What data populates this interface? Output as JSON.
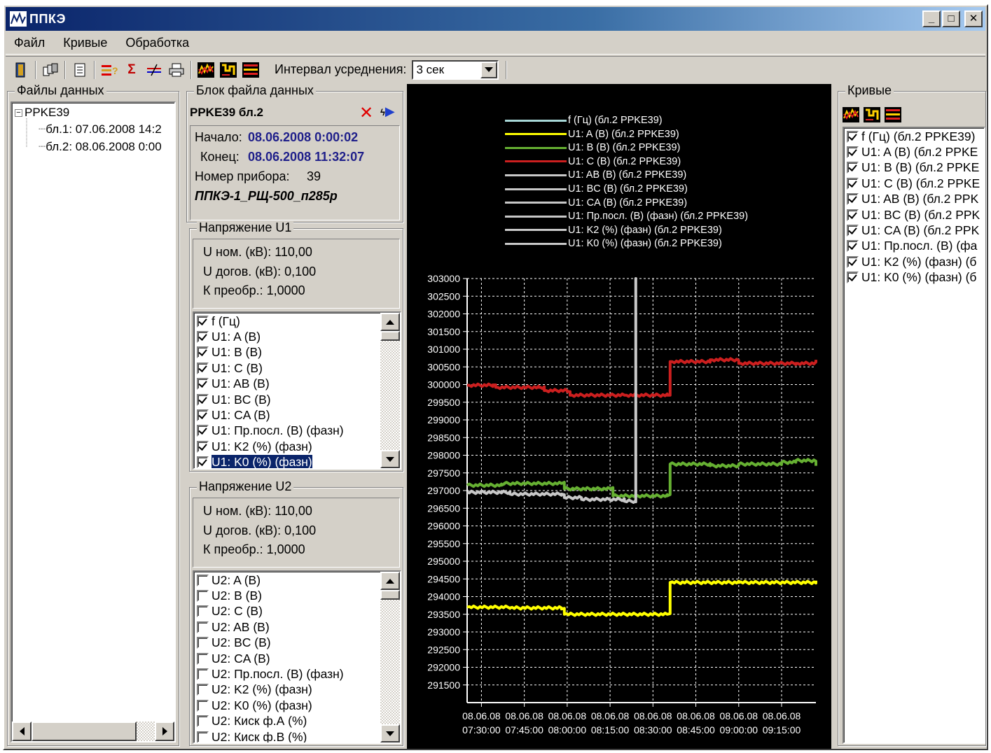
{
  "window": {
    "title": "ППКЭ",
    "minimize": "_",
    "maximize": "□",
    "close": "✕"
  },
  "menu": [
    "Файл",
    "Кривые",
    "Обработка"
  ],
  "toolbar": {
    "interval_label": "Интервал усреднения:",
    "interval_value": "3 сек",
    "icons": [
      "exit-icon",
      "database-icon",
      "report-icon",
      "table-icon",
      "sum-icon",
      "compare-icon",
      "print-icon",
      "curves-color-icon",
      "curves-yellow-icon",
      "curves-lines-icon"
    ]
  },
  "files_panel": {
    "title": "Файлы данных",
    "root": "PPKE39",
    "items": [
      "бл.1: 07.06.2008 14:2",
      "бл.2: 08.06.2008 0:00"
    ]
  },
  "block_panel": {
    "title": "Блок файла данных",
    "name": "PPKE39 бл.2",
    "start_label": "Начало:",
    "start_value": "08.06.2008 0:00:02",
    "end_label": "Конец:",
    "end_value": "08.06.2008 11:32:07",
    "device_label": "Номер прибора:",
    "device_value": "39",
    "device_name": "ППКЭ-1_РЩ-500_п285р"
  },
  "u1": {
    "title": "Напряжение U1",
    "unom": "U ном. (кВ): 110,00",
    "udog": "U догов. (кВ): 0,100",
    "kpr": "К преобр.: 1,0000",
    "items": [
      "f (Гц)",
      "U1: A (B)",
      "U1: B (B)",
      "U1: C (B)",
      "U1: AB (B)",
      "U1: BC (B)",
      "U1: CA (B)",
      "U1: Пр.посл. (В) (фазн)",
      "U1: K2 (%) (фазн)",
      "U1: K0 (%) (фазн)"
    ]
  },
  "u2": {
    "title": "Напряжение U2",
    "unom": "U ном. (кВ): 110,00",
    "udog": "U догов. (кВ): 0,100",
    "kpr": "К преобр.: 1,0000",
    "items": [
      "U2: A (B)",
      "U2: B (B)",
      "U2: C (B)",
      "U2: AB (B)",
      "U2: BC (B)",
      "U2: CA (B)",
      "U2: Пр.посл. (В) (фазн)",
      "U2: K2 (%) (фазн)",
      "U2: K0 (%) (фазн)",
      "U2: Киск ф.А (%)",
      "U2: Киск ф.В (%)"
    ]
  },
  "curves_panel": {
    "title": "Кривые",
    "items": [
      "f (Гц) (бл.2 PPKE39)",
      "U1: A (B) (бл.2 PPKE",
      "U1: B (B) (бл.2 PPKE",
      "U1: C (B) (бл.2 PPKE",
      "U1: AB (B) (бл.2 PPK",
      "U1: BC (B) (бл.2 PPK",
      "U1: CA (B) (бл.2 PPK",
      "U1: Пр.посл. (В) (фа",
      "U1: K2 (%) (фазн) (б",
      "U1: K0 (%) (фазн) (б"
    ]
  },
  "chart_data": {
    "type": "line",
    "background": "#000000",
    "legend": [
      {
        "name": "f (Гц) (бл.2 PPKE39)",
        "color": "#a8d8d8"
      },
      {
        "name": "U1: A (B) (бл.2 PPKE39)",
        "color": "#ffff00"
      },
      {
        "name": "U1: B (B) (бл.2 PPKE39)",
        "color": "#66b032"
      },
      {
        "name": "U1: C (B) (бл.2 PPKE39)",
        "color": "#cc1f1f"
      },
      {
        "name": "U1: AB (B) (бл.2 PPKE39)",
        "color": "#c8c8c8"
      },
      {
        "name": "U1: BC (B) (бл.2 PPKE39)",
        "color": "#c8c8c8"
      },
      {
        "name": "U1: CA (B) (бл.2 PPKE39)",
        "color": "#c8c8c8"
      },
      {
        "name": "U1: Пр.посл. (В) (фазн) (бл.2 PPKE39)",
        "color": "#c8c8c8"
      },
      {
        "name": "U1: K2 (%) (фазн) (бл.2 PPKE39)",
        "color": "#c8c8c8"
      },
      {
        "name": "U1: K0 (%) (фазн) (бл.2 PPKE39)",
        "color": "#c8c8c8"
      }
    ],
    "ylim": [
      291000,
      303000
    ],
    "yticks": [
      "303000",
      "302500",
      "302000",
      "301500",
      "301000",
      "300500",
      "300000",
      "299500",
      "299000",
      "298500",
      "298000",
      "297500",
      "297000",
      "296500",
      "296000",
      "295500",
      "295000",
      "294500",
      "294000",
      "293500",
      "293000",
      "292500",
      "292000",
      "291500"
    ],
    "xlim": [
      "08.06.2008 07:25",
      "08.06.2008 09:27"
    ],
    "xtick_dates": [
      "08.06.08",
      "08.06.08",
      "08.06.08",
      "08.06.08",
      "08.06.08",
      "08.06.08",
      "08.06.08",
      "08.06.08"
    ],
    "xtick_times": [
      "07:30:00",
      "07:45:00",
      "08:00:00",
      "08:15:00",
      "08:30:00",
      "08:45:00",
      "09:00:00",
      "09:15:00"
    ],
    "grid": true,
    "series": [
      {
        "name": "U1: C (B) (бл.2 PPKE39)",
        "color": "#cc1f1f",
        "points": [
          [
            "07:25",
            299980
          ],
          [
            "07:34",
            299990
          ],
          [
            "07:35",
            299920
          ],
          [
            "07:50",
            299920
          ],
          [
            "07:52",
            299830
          ],
          [
            "08:00",
            299800
          ],
          [
            "08:01",
            299700
          ],
          [
            "08:20",
            299700
          ],
          [
            "08:35",
            299700
          ],
          [
            "08:36",
            300650
          ],
          [
            "08:50",
            300700
          ],
          [
            "09:00",
            300600
          ],
          [
            "09:20",
            300600
          ],
          [
            "09:27",
            300700
          ]
        ]
      },
      {
        "name": "U1: B (B) (бл.2 PPKE39)",
        "color": "#66b032",
        "points": [
          [
            "07:25",
            297150
          ],
          [
            "07:37",
            297150
          ],
          [
            "07:38",
            297200
          ],
          [
            "07:58",
            297200
          ],
          [
            "07:59",
            297050
          ],
          [
            "08:15",
            297050
          ],
          [
            "08:16",
            296850
          ],
          [
            "08:35",
            296850
          ],
          [
            "08:36",
            297750
          ],
          [
            "08:50",
            297700
          ],
          [
            "09:00",
            297750
          ],
          [
            "09:15",
            297800
          ],
          [
            "09:20",
            297850
          ],
          [
            "09:27",
            297700
          ]
        ]
      },
      {
        "name": "U1: AB (B) (бл.2 PPKE39)",
        "color": "#c8c8c8",
        "points": [
          [
            "07:25",
            296950
          ],
          [
            "07:40",
            296900
          ],
          [
            "07:58",
            296900
          ],
          [
            "07:59",
            296800
          ],
          [
            "08:05",
            296750
          ],
          [
            "08:20",
            296700
          ],
          [
            "08:24",
            296700
          ],
          [
            "08:24",
            303000
          ],
          [
            "08:24",
            296700
          ]
        ]
      },
      {
        "name": "U1: A (B) (бл.2 PPKE39)",
        "color": "#ffff00",
        "points": [
          [
            "07:25",
            293700
          ],
          [
            "07:40",
            293680
          ],
          [
            "07:58",
            293650
          ],
          [
            "07:59",
            293500
          ],
          [
            "08:35",
            293500
          ],
          [
            "08:36",
            294400
          ],
          [
            "09:00",
            294400
          ],
          [
            "09:27",
            294450
          ]
        ]
      }
    ]
  }
}
